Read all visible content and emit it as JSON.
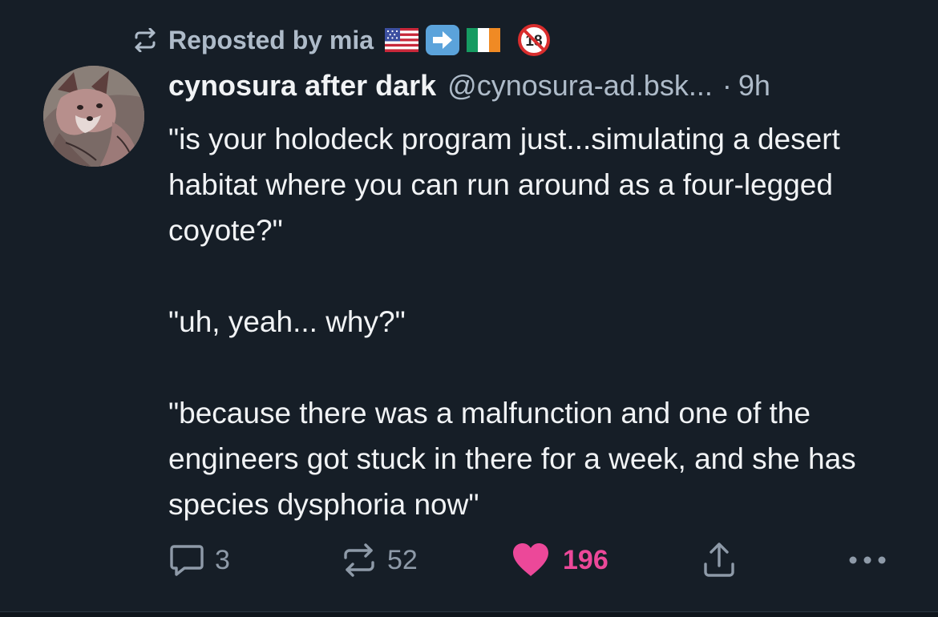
{
  "repost": {
    "label": "Reposted by mia",
    "icon": "repost-icon",
    "emojis": [
      "us-flag-emoji",
      "right-arrow-emoji",
      "ireland-flag-emoji",
      "no-under-18-emoji"
    ]
  },
  "post": {
    "display_name": "cynosura after dark",
    "handle": "@cynosura-ad.bsk...",
    "separator": "·",
    "time": "9h",
    "paragraphs": [
      "\"is your holodeck program just...simulating a desert habitat where you can run around as a four-legged coyote?\"",
      "\"uh, yeah... why?\"",
      "\"because there was a malfunction and one of the engineers got stuck in there for a week, and she has species dysphoria now\""
    ]
  },
  "actions": {
    "reply_count": "3",
    "repost_count": "52",
    "like_count": "196"
  },
  "colors": {
    "background": "#161e27",
    "text": "#f1f3f5",
    "muted": "#aebbc9",
    "like": "#ec4899"
  }
}
